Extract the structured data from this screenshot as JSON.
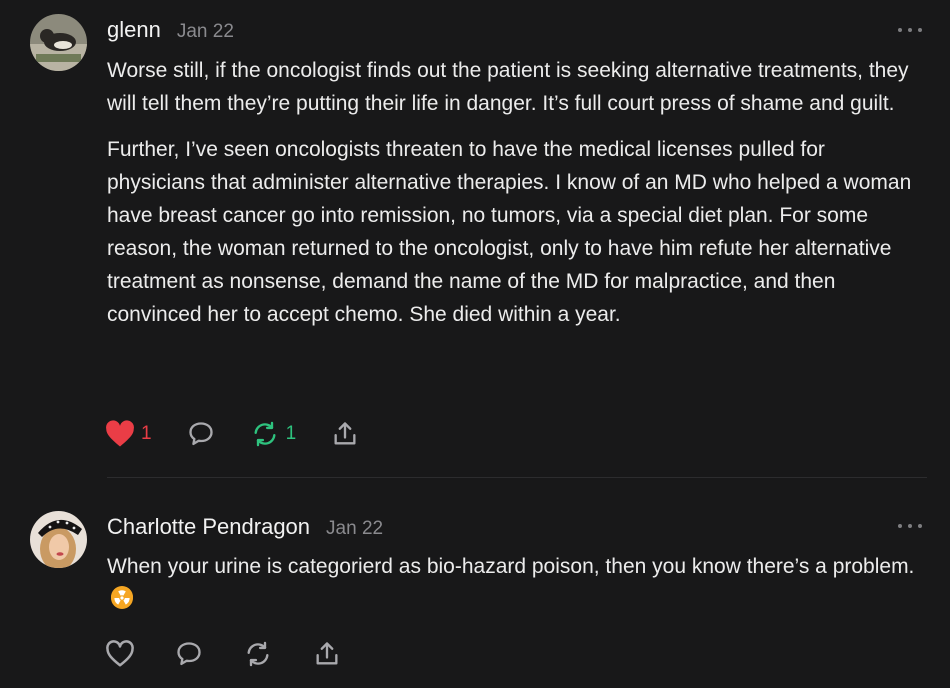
{
  "comments": [
    {
      "author": "glenn",
      "date": "Jan 22",
      "paragraphs": [
        "Worse still, if the oncologist finds out the patient is seeking alternative treatments, they will tell them they’re putting their life in danger. It’s full court press of shame and guilt.",
        "Further, I’ve seen oncologists threaten to have the medical licenses pulled for physicians that administer alternative therapies. I know of an MD who helped a woman have breast cancer go into remission, no tumors, via a special diet plan. For some reason, the woman returned to the oncologist, only to have him refute her alternative treatment as nonsense, demand the name of the MD for malpractice, and then convinced her to accept chemo. She died within a year."
      ],
      "likes": "1",
      "liked": true,
      "restacks": "1",
      "restacked": true
    },
    {
      "author": "Charlotte Pendragon",
      "date": "Jan 22",
      "text": "When your urine is categorierd as bio-hazard poison, then you know there’s a problem.",
      "emoji": "radioactive",
      "liked": false
    }
  ],
  "icons": {
    "like": "heart-icon",
    "reply": "speech-bubble-icon",
    "restack": "restack-arrows-icon",
    "share": "share-icon",
    "more": "more-dots-icon"
  },
  "colors": {
    "background": "#181819",
    "like_active": "#ea3d46",
    "restack_active": "#2ec27e",
    "muted": "#8a8a8e"
  }
}
